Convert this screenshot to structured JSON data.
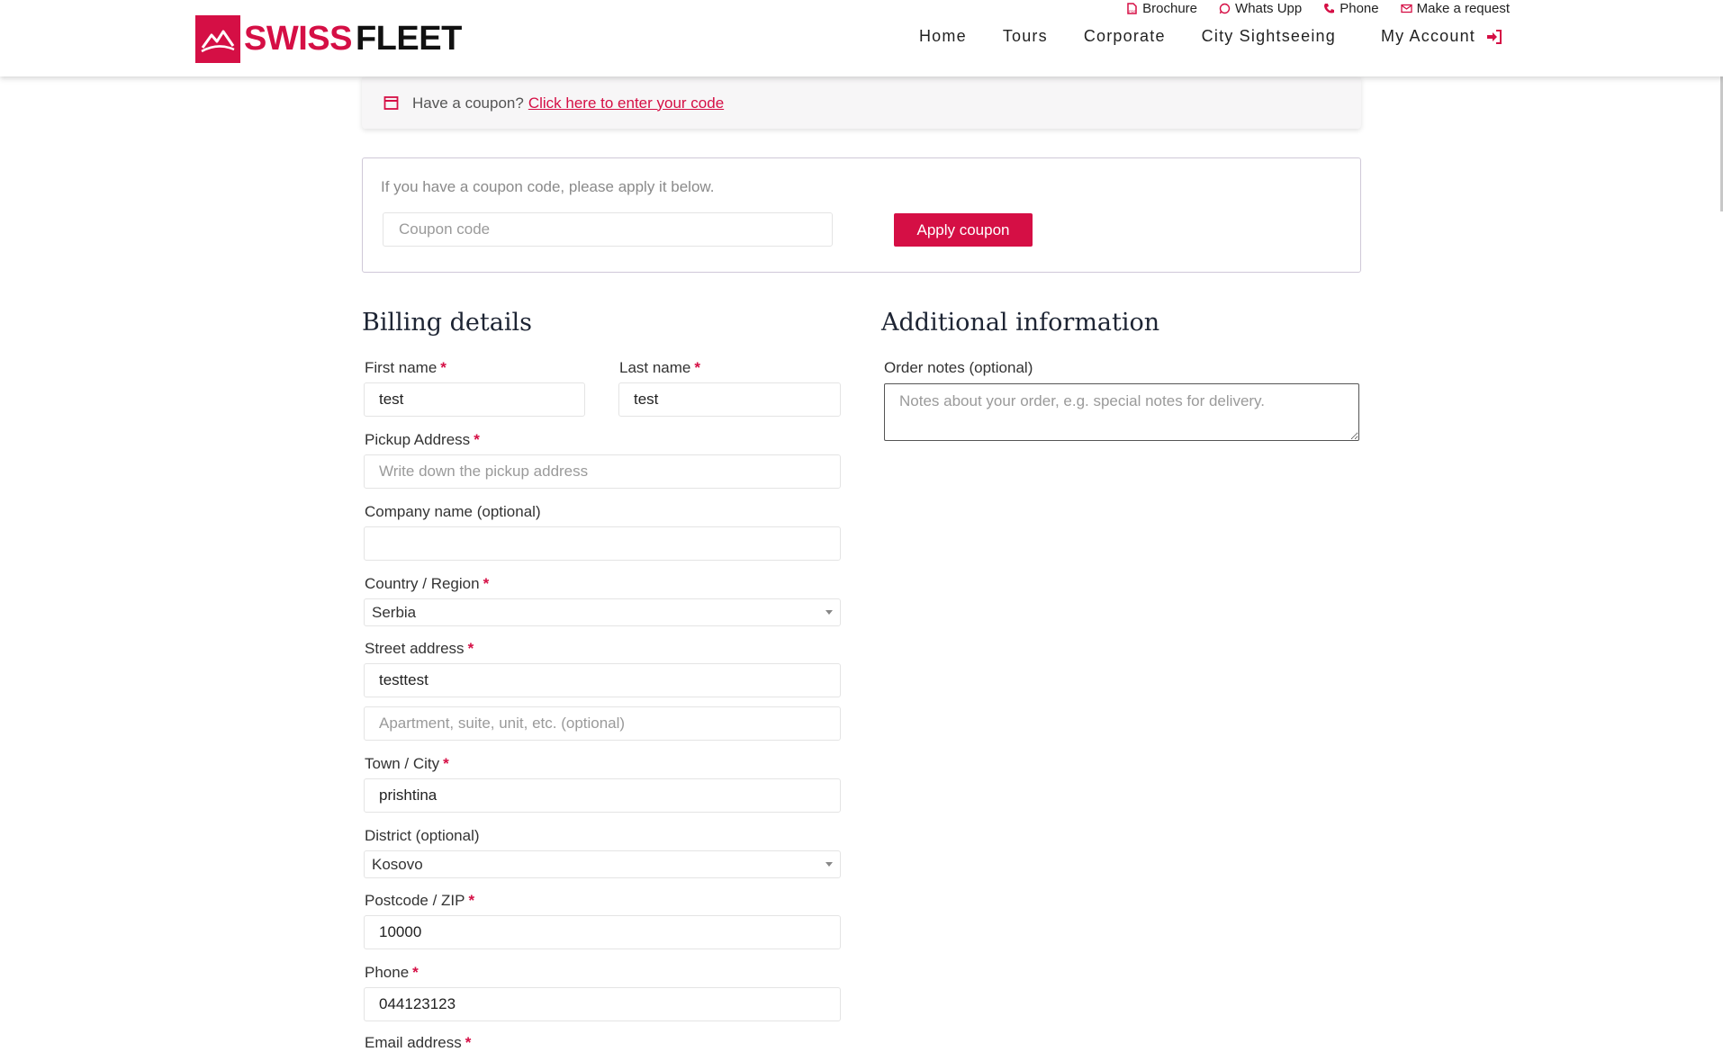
{
  "header": {
    "logo": {
      "swiss": "SWISS",
      "fleet": "FLEET"
    },
    "topbar": [
      {
        "label": "Brochure",
        "icon": "pdf-file-icon"
      },
      {
        "label": "Whats Upp",
        "icon": "whatsapp-icon"
      },
      {
        "label": "Phone",
        "icon": "phone-icon"
      },
      {
        "label": "Make a request",
        "icon": "envelope-icon"
      }
    ],
    "nav": {
      "home": "Home",
      "tours": "Tours",
      "corporate": "Corporate",
      "city_sightseeing": "City Sightseeing",
      "my_account": "My Account"
    }
  },
  "coupon_notice": {
    "text": "Have a coupon?",
    "link": "Click here to enter your code"
  },
  "coupon_form": {
    "hint": "If you have a coupon code, please apply it below.",
    "placeholder": "Coupon code",
    "button": "Apply coupon"
  },
  "billing": {
    "title": "Billing details",
    "first_name": {
      "label": "First name",
      "value": "test"
    },
    "last_name": {
      "label": "Last name",
      "value": "test"
    },
    "pickup_address": {
      "label": "Pickup Address",
      "placeholder": "Write down the pickup address"
    },
    "company": {
      "label": "Company name (optional)",
      "value": ""
    },
    "country": {
      "label": "Country / Region",
      "value": "Serbia"
    },
    "street": {
      "label": "Street address",
      "value": "testtest",
      "placeholder2": "Apartment, suite, unit, etc. (optional)"
    },
    "city": {
      "label": "Town / City",
      "value": "prishtina"
    },
    "district": {
      "label": "District (optional)",
      "value": "Kosovo"
    },
    "postcode": {
      "label": "Postcode / ZIP",
      "value": "10000"
    },
    "phone": {
      "label": "Phone",
      "value": "044123123"
    },
    "email": {
      "label": "Email address"
    }
  },
  "additional": {
    "title": "Additional information",
    "notes_label": "Order notes (optional)",
    "notes_placeholder": "Notes about your order, e.g. special notes for delivery."
  },
  "colors": {
    "brand": "#d50f45",
    "text": "#333333",
    "border": "#e4e4e4"
  },
  "required_marker": "*"
}
